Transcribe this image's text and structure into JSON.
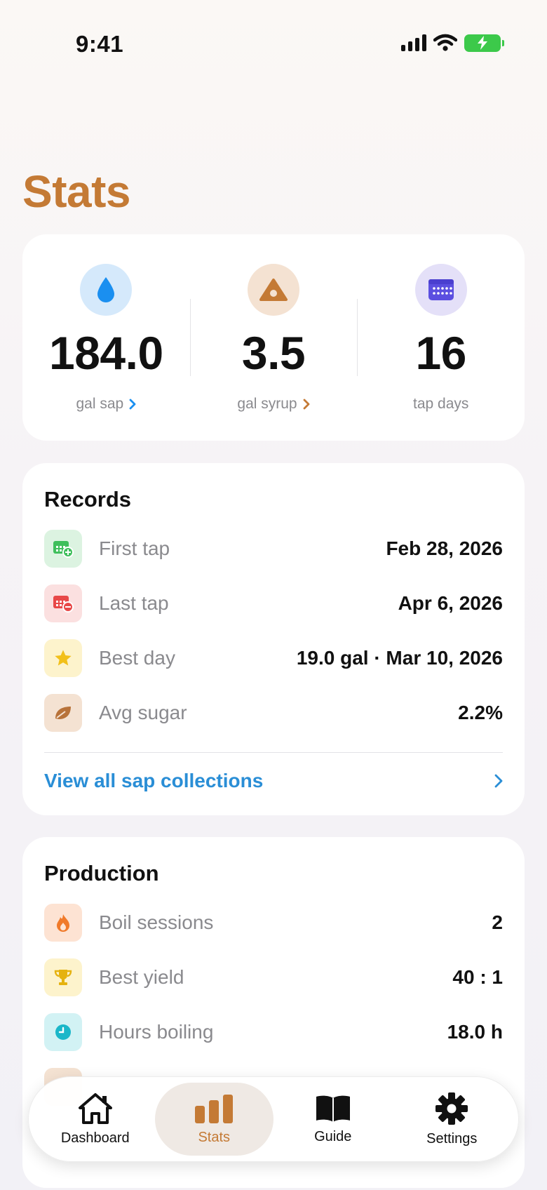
{
  "status_bar": {
    "time": "9:41"
  },
  "page": {
    "title": "Stats"
  },
  "summary": [
    {
      "value": "184.0",
      "label": "gal sap",
      "icon": "water-drop-icon",
      "has_link": true
    },
    {
      "value": "3.5",
      "label": "gal syrup",
      "icon": "syrup-drop-icon",
      "has_link": true
    },
    {
      "value": "16",
      "label": "tap days",
      "icon": "calendar-icon",
      "has_link": false
    }
  ],
  "records": {
    "title": "Records",
    "rows": [
      {
        "label": "First tap",
        "value": "Feb 28, 2026",
        "icon": "calendar-add-icon"
      },
      {
        "label": "Last tap",
        "value": "Apr 6, 2026",
        "icon": "calendar-remove-icon"
      },
      {
        "label": "Best day",
        "value": "19.0 gal · Mar 10, 2026",
        "icon": "star-icon"
      },
      {
        "label": "Avg sugar",
        "value": "2.2%",
        "icon": "leaf-icon"
      }
    ],
    "link": "View all sap collections"
  },
  "production": {
    "title": "Production",
    "rows": [
      {
        "label": "Boil sessions",
        "value": "2",
        "icon": "flame-icon"
      },
      {
        "label": "Best yield",
        "value": "40 : 1",
        "icon": "trophy-icon"
      },
      {
        "label": "Hours boiling",
        "value": "18.0 h",
        "icon": "clock-icon"
      }
    ]
  },
  "tabbar": {
    "items": [
      {
        "label": "Dashboard",
        "icon": "house-icon",
        "active": false
      },
      {
        "label": "Stats",
        "icon": "bar-chart-icon",
        "active": true
      },
      {
        "label": "Guide",
        "icon": "book-icon",
        "active": false
      },
      {
        "label": "Settings",
        "icon": "gear-icon",
        "active": false
      }
    ]
  },
  "colors": {
    "accent": "#c47a35",
    "link": "#2a8ed6",
    "sap_blue": "#1a8ff0",
    "calendar_purple": "#5b4fe0"
  }
}
